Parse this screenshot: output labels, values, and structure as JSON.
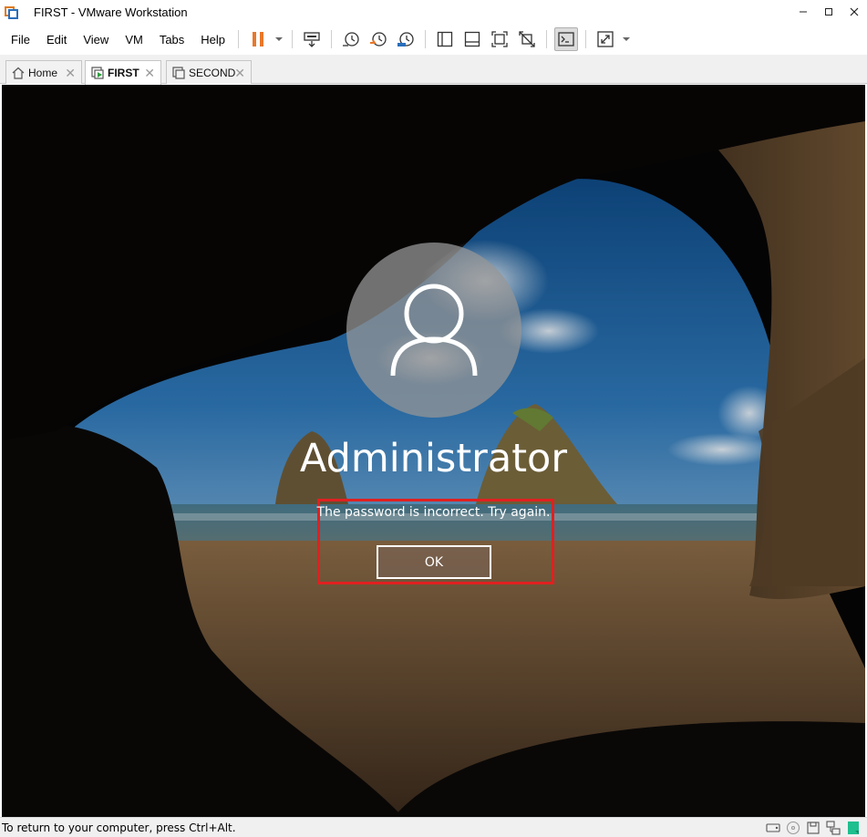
{
  "window": {
    "title": "FIRST - VMware Workstation",
    "minimize": "–",
    "maximize": "□",
    "close": "✕"
  },
  "menu": {
    "items": [
      {
        "label": "File"
      },
      {
        "label": "Edit"
      },
      {
        "label": "View"
      },
      {
        "label": "VM"
      },
      {
        "label": "Tabs"
      },
      {
        "label": "Help"
      }
    ]
  },
  "toolbar": {
    "icons": [
      "pause-icon",
      "send-ctrl-alt-del-icon",
      "snapshot-icon",
      "revert-snapshot-icon",
      "snapshot-manager-icon",
      "library-icon",
      "thumbnail-bar-icon",
      "full-screen-icon",
      "unity-icon",
      "console-view-icon",
      "stretch-icon"
    ],
    "accent": "#e8782a"
  },
  "tabs": [
    {
      "label": "Home",
      "icon": "home-icon",
      "close": "✕",
      "active": false
    },
    {
      "label": "FIRST",
      "icon": "vm-running-icon",
      "close": "✕",
      "active": true
    },
    {
      "label": "SECOND",
      "icon": "vm-icon",
      "close": "✕",
      "active": false
    }
  ],
  "login": {
    "username": "Administrator",
    "message": "The password is incorrect. Try again.",
    "ok_label": "OK",
    "highlight_color": "#e02020"
  },
  "status": {
    "text": "To return to your computer, press Ctrl+Alt."
  }
}
